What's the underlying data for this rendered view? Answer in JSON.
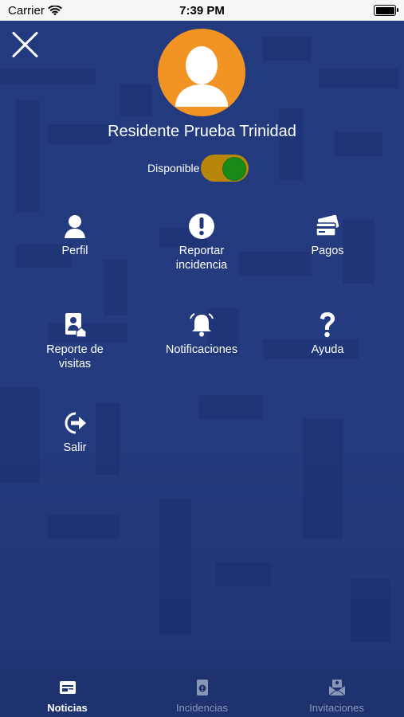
{
  "status_bar": {
    "carrier": "Carrier",
    "time": "7:39 PM"
  },
  "profile": {
    "name": "Residente Prueba Trinidad",
    "availability_label": "Disponible",
    "available": true
  },
  "colors": {
    "primary": "#233a7e",
    "avatar": "#f29423",
    "toggle_track": "#b8860b",
    "toggle_knob": "#1a8a16"
  },
  "menu": {
    "items": [
      {
        "icon": "user-icon",
        "label_1": "Perfil",
        "label_2": ""
      },
      {
        "icon": "exclamation-icon",
        "label_1": "Reportar",
        "label_2": "incidencia"
      },
      {
        "icon": "card-icon",
        "label_1": "Pagos",
        "label_2": ""
      },
      {
        "icon": "visit-report-icon",
        "label_1": "Reporte de",
        "label_2": "visitas"
      },
      {
        "icon": "bell-icon",
        "label_1": "Notificaciones",
        "label_2": ""
      },
      {
        "icon": "question-icon",
        "label_1": "Ayuda",
        "label_2": ""
      },
      {
        "icon": "logout-icon",
        "label_1": "Salir",
        "label_2": ""
      }
    ]
  },
  "tabbar": {
    "tabs": [
      {
        "icon": "news-icon",
        "label": "Noticias",
        "active": true
      },
      {
        "icon": "incident-icon",
        "label": "Incidencias",
        "active": false
      },
      {
        "icon": "invitation-icon",
        "label": "Invitaciones",
        "active": false
      }
    ]
  }
}
